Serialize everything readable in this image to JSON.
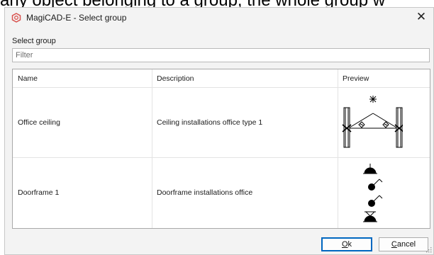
{
  "background_text": "any object belonging to a group, the whole group w",
  "window": {
    "title": "MagiCAD-E - Select group",
    "close_symbol": "✕",
    "app_icon": "magicad-logo-icon"
  },
  "select_group_label": "Select group",
  "filter": {
    "placeholder": "Filter",
    "value": ""
  },
  "grid": {
    "columns": [
      "Name",
      "Description",
      "Preview"
    ],
    "rows": [
      {
        "name": "Office ceiling",
        "description": "Ceiling installations office type 1",
        "preview_icon": "ceiling-installation-symbol-icon"
      },
      {
        "name": "Doorframe 1",
        "description": "Doorframe installations office",
        "preview_icon": "doorframe-installation-symbol-icon"
      }
    ]
  },
  "buttons": {
    "ok": {
      "mnemonic": "O",
      "rest": "k"
    },
    "cancel": {
      "mnemonic": "C",
      "rest": "ancel"
    }
  },
  "colors": {
    "accent": "#0067c0",
    "logo": "#d9534f"
  }
}
